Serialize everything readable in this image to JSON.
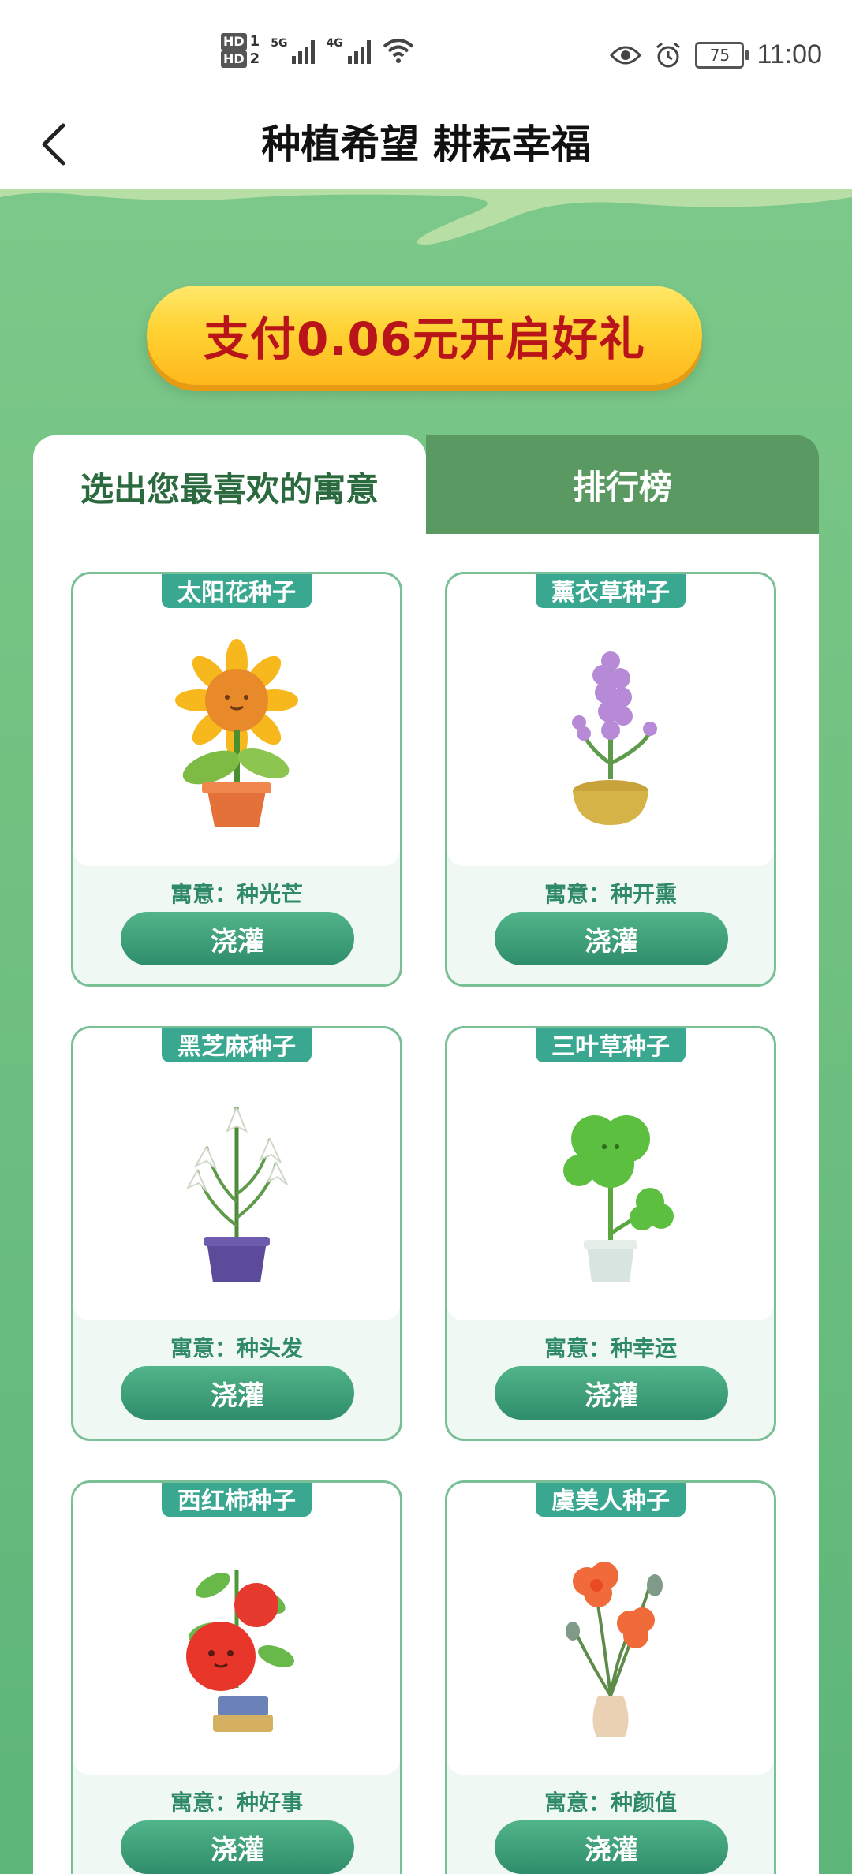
{
  "status_bar": {
    "hd1": "HD",
    "hd1_num": "1",
    "hd2": "HD",
    "hd2_num": "2",
    "net1": "5G",
    "net2": "4G",
    "battery": "75",
    "time": "11:00"
  },
  "header": {
    "title": "种植希望 耕耘幸福"
  },
  "banner": {
    "pay_button": "支付0.06元开启好礼"
  },
  "tabs": [
    {
      "label": "选出您最喜欢的寓意",
      "active": true
    },
    {
      "label": "排行榜",
      "active": false
    }
  ],
  "cards": [
    {
      "name": "太阳花种子",
      "meaning": "寓意：种光芒",
      "button": "浇灌",
      "icon": "sunflower-icon"
    },
    {
      "name": "薰衣草种子",
      "meaning": "寓意：种开熏",
      "button": "浇灌",
      "icon": "lavender-icon"
    },
    {
      "name": "黑芝麻种子",
      "meaning": "寓意：种头发",
      "button": "浇灌",
      "icon": "lily-icon"
    },
    {
      "name": "三叶草种子",
      "meaning": "寓意：种幸运",
      "button": "浇灌",
      "icon": "clover-icon"
    },
    {
      "name": "西红柿种子",
      "meaning": "寓意：种好事",
      "button": "浇灌",
      "icon": "tomato-icon"
    },
    {
      "name": "虞美人种子",
      "meaning": "寓意：种颜值",
      "button": "浇灌",
      "icon": "poppy-icon"
    }
  ],
  "colors": {
    "primary_green": "#3aa890",
    "banner_green": "#74c383",
    "pay_text": "#b8141a",
    "pay_bg": "#ffd233"
  }
}
